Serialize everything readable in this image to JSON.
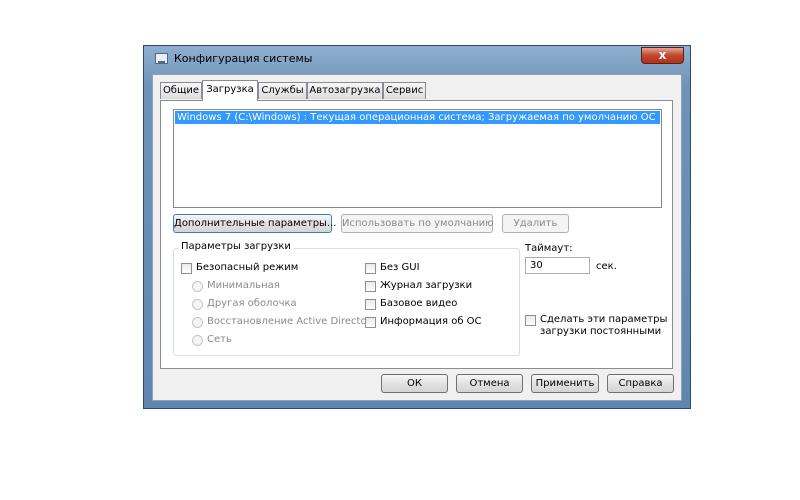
{
  "window": {
    "title": "Конфигурация системы",
    "close_glyph": "x",
    "title_icon": "msconfig-icon"
  },
  "tabs": [
    {
      "label": "Общие",
      "active": false
    },
    {
      "label": "Загрузка",
      "active": true
    },
    {
      "label": "Службы",
      "active": false
    },
    {
      "label": "Автозагрузка",
      "active": false
    },
    {
      "label": "Сервис",
      "active": false
    }
  ],
  "os_list": {
    "items": [
      "Windows 7 (C:\\Windows) : Текущая операционная система; Загружаемая по умолчанию ОС"
    ],
    "selected_index": 0
  },
  "list_buttons": {
    "advanced": "Дополнительные параметры...",
    "set_default": "Использовать по умолчанию",
    "delete": "Удалить"
  },
  "boot_options": {
    "group_label": "Параметры загрузки",
    "safe_mode": {
      "label": "Безопасный режим",
      "checked": false
    },
    "radios": [
      "Минимальная",
      "Другая оболочка",
      "Восстановление Active Directory",
      "Сеть"
    ],
    "no_gui": {
      "label": "Без GUI",
      "checked": false
    },
    "boot_log": {
      "label": "Журнал загрузки",
      "checked": false
    },
    "base_video": {
      "label": "Базовое видео",
      "checked": false
    },
    "os_info": {
      "label": "Информация  об ОС",
      "checked": false
    }
  },
  "timeout": {
    "label": "Таймаут:",
    "value": "30",
    "unit": "сек."
  },
  "persistent": {
    "label_line1": "Сделать эти параметры",
    "label_line2": "загрузки постоянными",
    "checked": false
  },
  "footer_buttons": {
    "ok": "ОК",
    "cancel": "Отмена",
    "apply": "Применить",
    "help": "Справка"
  },
  "colors": {
    "selection": "#3399ff",
    "frame": "#6f93b8",
    "close_button": "#c2462f"
  }
}
